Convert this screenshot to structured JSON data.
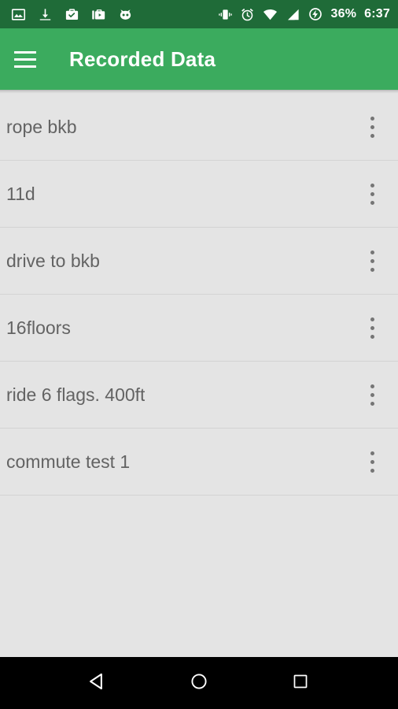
{
  "status_bar": {
    "background_color": "#1f6b38",
    "left_icons": [
      {
        "name": "image-icon",
        "label": "image"
      },
      {
        "name": "download-icon",
        "label": "download"
      },
      {
        "name": "briefcase-check-icon",
        "label": "work-check"
      },
      {
        "name": "briefcase-play-icon",
        "label": "work-play"
      },
      {
        "name": "cyanogenmod-icon",
        "label": "cyanogenmod"
      }
    ],
    "right_icons": [
      {
        "name": "vibrate-icon",
        "label": "vibrate"
      },
      {
        "name": "alarm-icon",
        "label": "alarm"
      },
      {
        "name": "wifi-icon",
        "label": "wifi"
      },
      {
        "name": "signal-icon",
        "label": "cellular-signal"
      },
      {
        "name": "battery-charging-icon",
        "label": "battery-charging"
      }
    ],
    "battery_percent": "36%",
    "clock": "6:37"
  },
  "app_bar": {
    "background_color": "#3bab5e",
    "menu_icon": "hamburger-menu-icon",
    "title": "Recorded Data"
  },
  "list": {
    "background_color": "#e4e4e4",
    "overflow_icon": "more-vertical-icon",
    "items": [
      {
        "label": "rope bkb"
      },
      {
        "label": "11d"
      },
      {
        "label": "drive to bkb"
      },
      {
        "label": "16floors"
      },
      {
        "label": "ride 6 flags. 400ft"
      },
      {
        "label": "commute test 1"
      }
    ]
  },
  "nav_bar": {
    "background_color": "#000000",
    "buttons": [
      {
        "name": "back-button",
        "icon": "back-triangle-icon"
      },
      {
        "name": "home-button",
        "icon": "home-circle-icon"
      },
      {
        "name": "recents-button",
        "icon": "recents-square-icon"
      }
    ]
  }
}
